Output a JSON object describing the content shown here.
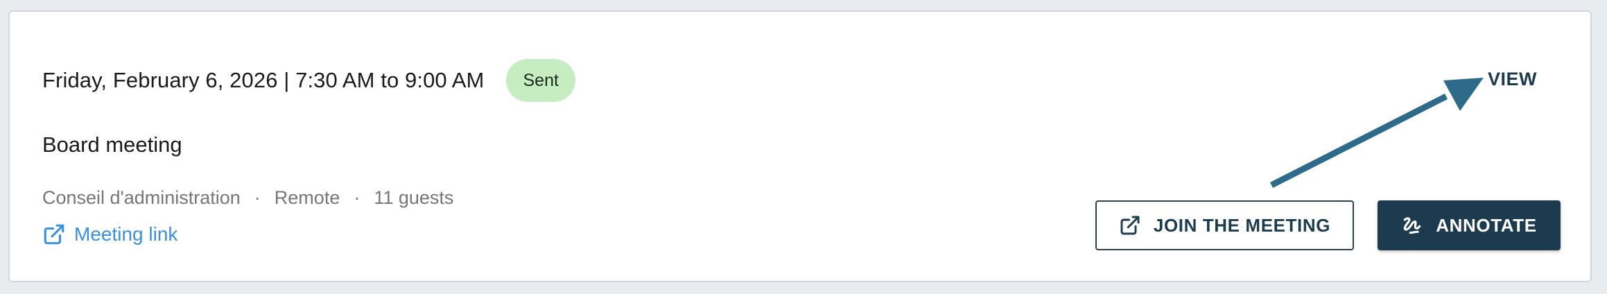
{
  "event": {
    "date_line": "Friday, February 6, 2026 | 7:30 AM to 9:00 AM",
    "status": "Sent",
    "title": "Board meeting",
    "meta": {
      "group": "Conseil d'administration",
      "separator": "·",
      "location": "Remote",
      "guests": "11 guests"
    },
    "meeting_link_label": "Meeting link"
  },
  "actions": {
    "view_label": "VIEW",
    "join_label": "JOIN THE MEETING",
    "annotate_label": "ANNOTATE"
  },
  "icons": {
    "meeting_link": "external-link-icon",
    "join": "external-link-icon",
    "annotate": "signature-icon"
  },
  "colors": {
    "accent_dark": "#1d3b4f",
    "link_blue": "#3a8fe0",
    "badge_green": "#c6ecc1",
    "annotation_arrow": "#2e6a8a"
  }
}
